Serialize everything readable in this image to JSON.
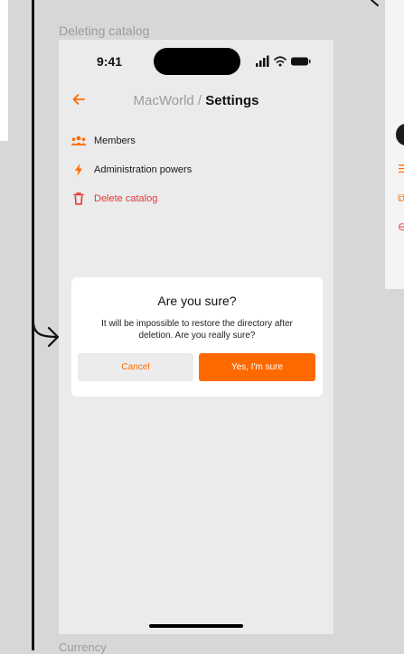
{
  "frame": {
    "title": "Deleting catalog",
    "next_frame_label": "Currency"
  },
  "status_bar": {
    "time": "9:41",
    "icons": [
      "signal-icon",
      "wifi-icon",
      "battery-icon"
    ]
  },
  "nav": {
    "back_icon": "arrow-left-icon",
    "breadcrumb_parent": "MacWorld",
    "separator": " / ",
    "current": "Settings"
  },
  "menu": {
    "items": [
      {
        "label": "Members",
        "icon": "users-icon"
      },
      {
        "label": "Administration powers",
        "icon": "lightning-icon"
      },
      {
        "label": "Delete catalog",
        "icon": "trash-icon",
        "danger": true
      }
    ]
  },
  "dialog": {
    "title": "Are you sure?",
    "message": "It will be impossible to restore the directory after deletion. Are you really sure?",
    "cancel_label": "Cancel",
    "confirm_label": "Yes, I'm sure"
  },
  "colors": {
    "accent": "#ff6a00",
    "danger": "#e53935",
    "screen_bg": "#ebebeb",
    "canvas_bg": "#d7d7d7"
  }
}
